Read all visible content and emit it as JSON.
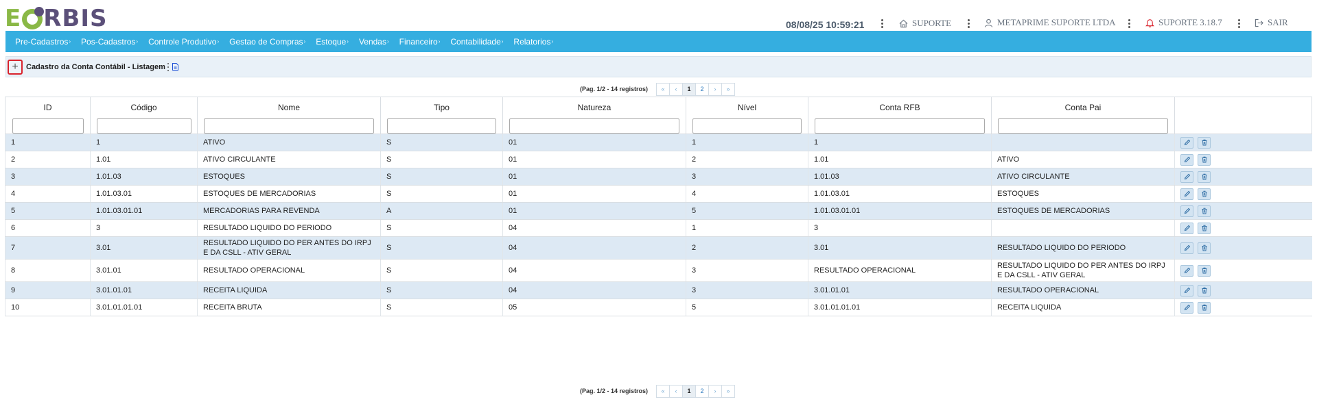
{
  "logo": {
    "first": "E",
    "rest": "RBIS"
  },
  "header": {
    "datetime": "08/08/25 10:59:21",
    "items": [
      {
        "label": "SUPORTE",
        "icon": "home-icon"
      },
      {
        "label": "METAPRIME SUPORTE LTDA",
        "icon": "user-icon"
      },
      {
        "label": "SUPORTE 3.18.7",
        "icon": "bell-icon"
      },
      {
        "label": "SAIR",
        "icon": "logout-icon"
      }
    ]
  },
  "nav": {
    "items": [
      "Pre-Cadastros",
      "Pos-Cadastros",
      "Controle Produtivo",
      "Gestao de Compras",
      "Estoque",
      "Vendas",
      "Financeiro",
      "Contabilidade",
      "Relatorios"
    ],
    "caret": "›"
  },
  "breadcrumb": {
    "add": "+",
    "title": "Cadastro da Conta Contábil - Listagem"
  },
  "pagination": {
    "info": "(Pag. 1/2 - 14 registros)",
    "first": "«",
    "prev": "‹",
    "pages": [
      "1",
      "2"
    ],
    "next": "›",
    "last": "»"
  },
  "table": {
    "columns": [
      "ID",
      "Código",
      "Nome",
      "Tipo",
      "Natureza",
      "Nível",
      "Conta RFB",
      "Conta Pai"
    ],
    "rows": [
      [
        "1",
        "1",
        "ATIVO",
        "S",
        "01",
        "1",
        "1",
        ""
      ],
      [
        "2",
        "1.01",
        "ATIVO CIRCULANTE",
        "S",
        "01",
        "2",
        "1.01",
        "ATIVO"
      ],
      [
        "3",
        "1.01.03",
        "ESTOQUES",
        "S",
        "01",
        "3",
        "1.01.03",
        "ATIVO CIRCULANTE"
      ],
      [
        "4",
        "1.01.03.01",
        "ESTOQUES DE MERCADORIAS",
        "S",
        "01",
        "4",
        "1.01.03.01",
        "ESTOQUES"
      ],
      [
        "5",
        "1.01.03.01.01",
        "MERCADORIAS PARA REVENDA",
        "A",
        "01",
        "5",
        "1.01.03.01.01",
        "ESTOQUES DE MERCADORIAS"
      ],
      [
        "6",
        "3",
        "RESULTADO LIQUIDO DO PERIODO",
        "S",
        "04",
        "1",
        "3",
        ""
      ],
      [
        "7",
        "3.01",
        "RESULTADO LIQUIDO DO PER ANTES DO IRPJ E DA CSLL - ATIV GERAL",
        "S",
        "04",
        "2",
        "3.01",
        "RESULTADO LIQUIDO DO PERIODO"
      ],
      [
        "8",
        "3.01.01",
        "RESULTADO OPERACIONAL",
        "S",
        "04",
        "3",
        "RESULTADO OPERACIONAL",
        "RESULTADO LIQUIDO DO PER ANTES DO IRPJ E DA CSLL - ATIV GERAL"
      ],
      [
        "9",
        "3.01.01.01",
        "RECEITA LIQUIDA",
        "S",
        "04",
        "3",
        "3.01.01.01",
        "RESULTADO OPERACIONAL"
      ],
      [
        "10",
        "3.01.01.01.01",
        "RECEITA BRUTA",
        "S",
        "05",
        "5",
        "3.01.01.01.01",
        "RECEITA LIQUIDA"
      ]
    ]
  },
  "colors": {
    "nav_bg": "#35aee0",
    "row_alt": "#dde9f4",
    "accent_red": "#d9232d",
    "logo_green": "#8ab846",
    "logo_purple": "#5b4f79"
  }
}
